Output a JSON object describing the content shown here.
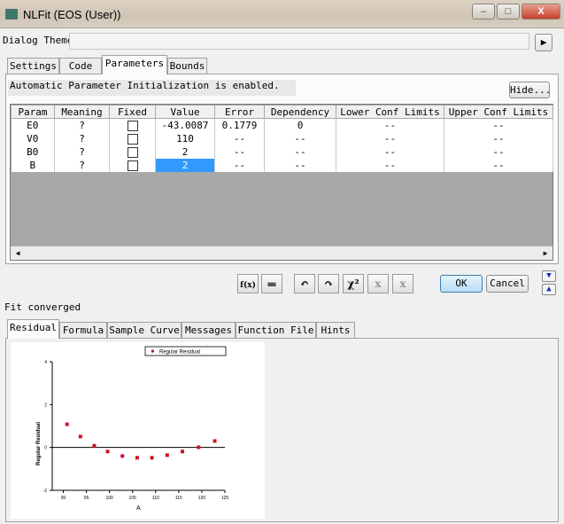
{
  "window": {
    "title": "NLFit (EOS (User))",
    "minimize": "–",
    "maximize": "□",
    "close": "X"
  },
  "theme": {
    "label": "Dialog Theme",
    "value": ""
  },
  "top_tabs": [
    {
      "label": "Settings"
    },
    {
      "label": "Code"
    },
    {
      "label": "Parameters",
      "active": true
    },
    {
      "label": "Bounds"
    }
  ],
  "info": {
    "text": "Automatic Parameter Initialization is enabled.",
    "hide_label": "Hide..."
  },
  "table": {
    "columns": [
      "Param",
      "Meaning",
      "Fixed",
      "Value",
      "Error",
      "Dependency",
      "Lower Conf Limits",
      "Upper Conf Limits"
    ],
    "rows": [
      {
        "param": "E0",
        "meaning": "?",
        "fixed": false,
        "value": "-43.0087",
        "error": "0.1779",
        "dependency": "0",
        "lower": "--",
        "upper": "--"
      },
      {
        "param": "V0",
        "meaning": "?",
        "fixed": false,
        "value": "110",
        "error": "--",
        "dependency": "--",
        "lower": "--",
        "upper": "--"
      },
      {
        "param": "B0",
        "meaning": "?",
        "fixed": false,
        "value": "2",
        "error": "--",
        "dependency": "--",
        "lower": "--",
        "upper": "--"
      },
      {
        "param": "B",
        "meaning": "?",
        "fixed": false,
        "value": "2",
        "error": "--",
        "dependency": "--",
        "lower": "--",
        "upper": "--",
        "selected": true
      }
    ]
  },
  "toolbar": {
    "icons": [
      "fx-icon",
      "save-icon",
      "one-iteration-icon",
      "fit-until-converge-icon",
      "chi-square-icon",
      "one-iteration-step-icon",
      "fit-step-icon"
    ],
    "chi_label": "χ²",
    "ok": "OK",
    "cancel": "Cancel"
  },
  "status": "Fit converged",
  "bottom_tabs": [
    {
      "label": "Residual",
      "active": true
    },
    {
      "label": "Formula"
    },
    {
      "label": "Sample Curve"
    },
    {
      "label": "Messages"
    },
    {
      "label": "Function File"
    },
    {
      "label": "Hints"
    }
  ],
  "chart_data": {
    "type": "scatter",
    "xlabel": "A",
    "ylabel": "Regular Residual",
    "xlim": [
      87.6,
      125
    ],
    "ylim": [
      -2,
      4
    ],
    "xticks": [
      90,
      95,
      100,
      105,
      110,
      115,
      120,
      125
    ],
    "yticks": [
      -2,
      0,
      2,
      4
    ],
    "series": [
      {
        "name": "Regular Residual",
        "color": "#d0102a",
        "x": [
          90.8,
          93.7,
          96.7,
          99.6,
          102.8,
          106.0,
          109.2,
          112.5,
          115.8,
          119.3,
          122.8
        ],
        "y": [
          1.08,
          0.51,
          0.08,
          -0.19,
          -0.4,
          -0.48,
          -0.48,
          -0.36,
          -0.19,
          0.01,
          0.3
        ]
      }
    ],
    "zero_line": true,
    "legend": "top-right",
    "grid": false
  }
}
